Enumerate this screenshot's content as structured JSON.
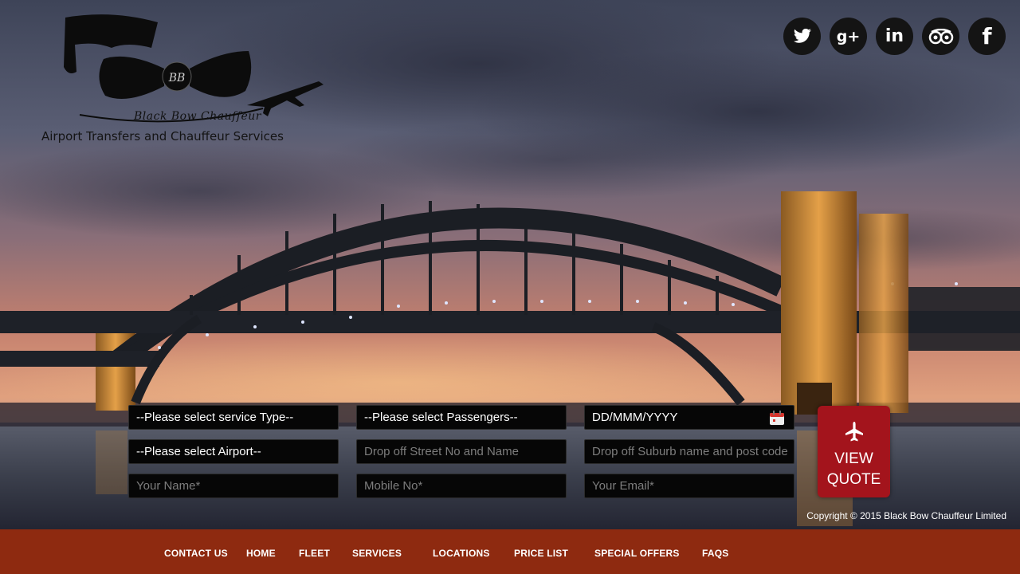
{
  "brand": {
    "name": "Black Bow Chauffeur",
    "monogram": "BB",
    "tagline": "Airport Transfers and Chauffeur Services"
  },
  "social": [
    {
      "name": "twitter-icon",
      "glyph": "🐦"
    },
    {
      "name": "google-plus-icon",
      "glyph": "g+"
    },
    {
      "name": "linkedin-icon",
      "glyph": "in"
    },
    {
      "name": "tripadvisor-icon",
      "glyph": "oo"
    },
    {
      "name": "facebook-icon",
      "glyph": "f"
    }
  ],
  "form": {
    "service_type": "--Please select service Type--",
    "passengers": "--Please select Passengers--",
    "date": "DD/MMM/YYYY",
    "airport": "--Please select Airport--",
    "street_placeholder": "Drop off Street No and Name",
    "suburb_placeholder": "Drop off Suburb name and post code",
    "name_placeholder": "Your Name*",
    "mobile_placeholder": "Mobile No*",
    "email_placeholder": "Your Email*",
    "quote_line1": "VIEW",
    "quote_line2": "QUOTE"
  },
  "copyright": "Copyright © 2015 Black Bow Chauffeur Limited",
  "nav": [
    "CONTACT US",
    "HOME",
    "FLEET",
    "SERVICES",
    "LOCATIONS",
    "PRICE LIST",
    "SPECIAL OFFERS",
    "FAQS"
  ],
  "colors": {
    "footer": "#8e2a10",
    "quote_button": "#a3141c",
    "field_bg": "#060606"
  }
}
